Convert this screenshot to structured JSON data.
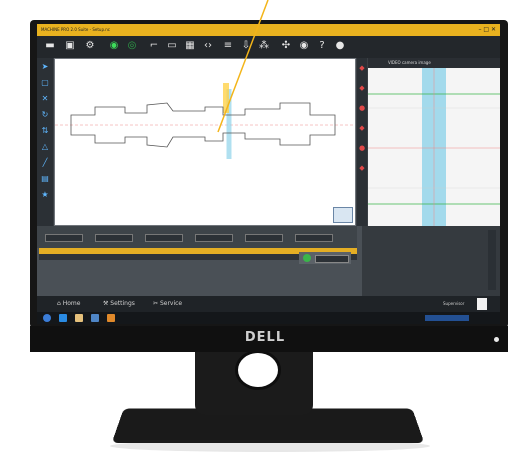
{
  "window": {
    "title": "MACHINE PRO 2.0 Suite - Setup.nc",
    "controls": "– □ ✕"
  },
  "toolbar": {
    "icons": [
      "folder-icon",
      "save-icon",
      "settings-icon",
      "play-icon",
      "stop-icon",
      "measure-icon",
      "frame-icon",
      "grid-icon",
      "code-icon",
      "align-icon",
      "down-arrow-icon",
      "spread-icon",
      "move-icon",
      "eye-icon",
      "help-icon",
      "info-icon"
    ]
  },
  "detail_panel": {
    "title": "VIDEO camera image"
  },
  "footer_nav": {
    "home": "Home",
    "settings": "Settings",
    "service": "Service",
    "user": "Supervisor"
  },
  "brand": {
    "logo": "DELL"
  },
  "colors": {
    "accent": "#e9b21f",
    "background": "#3a3f44",
    "canvas": "#ffffff",
    "detail_cyan": "#8fd3ea"
  }
}
